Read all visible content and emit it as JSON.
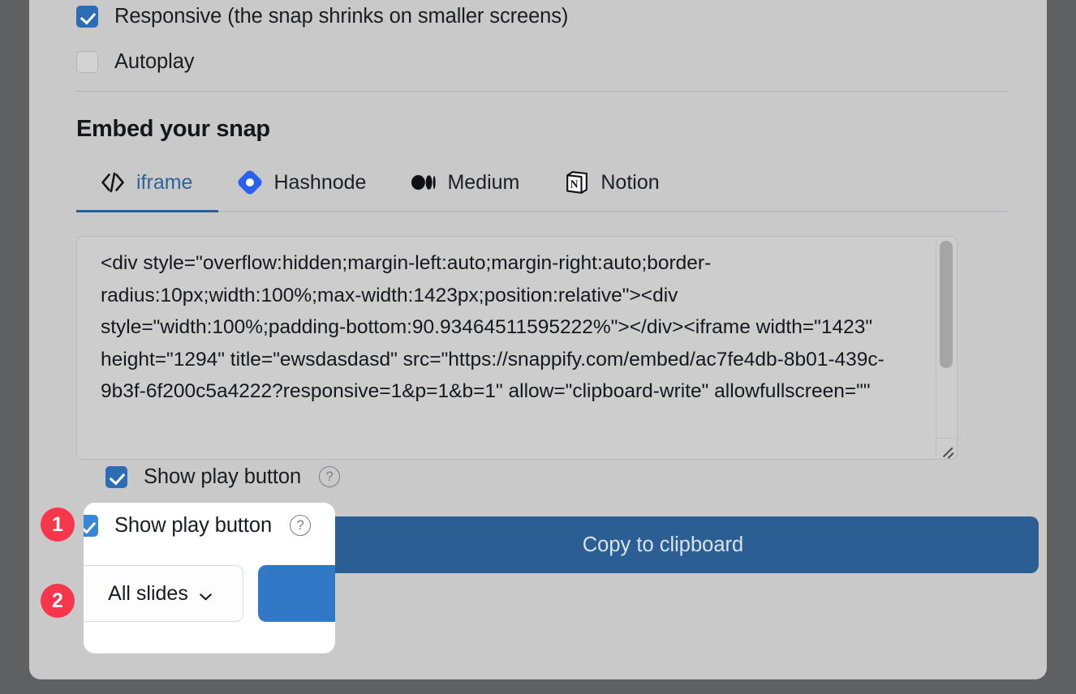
{
  "options": [
    {
      "label": "Responsive (the snap shrinks on smaller screens)",
      "checked": true,
      "name": "responsive"
    },
    {
      "label": "Autoplay",
      "checked": false,
      "name": "autoplay"
    }
  ],
  "section": {
    "title": "Embed your snap"
  },
  "tabs": [
    {
      "label": "iframe",
      "icon": "code-brackets-icon",
      "active": true
    },
    {
      "label": "Hashnode",
      "icon": "hashnode-icon",
      "active": false
    },
    {
      "label": "Medium",
      "icon": "medium-icon",
      "active": false
    },
    {
      "label": "Notion",
      "icon": "notion-icon",
      "active": false
    }
  ],
  "code": {
    "value": "<div style=\"overflow:hidden;margin-left:auto;margin-right:auto;border-radius:10px;width:100%;max-width:1423px;position:relative\"><div style=\"width:100%;padding-bottom:90.93464511595222%\"></div><iframe width=\"1423\" height=\"1294\" title=\"ewsdasdasd\" src=\"https://snappify.com/embed/ac7fe4db-8b01-439c-9b3f-6f200c5a4222?responsive=1&p=1&b=1\" allow=\"clipboard-write\" allowfullscreen=\"\""
  },
  "controls": {
    "play_button_label": "Show play button",
    "play_button_checked": true,
    "help_icon_glyph": "?",
    "slides_select_value": "All slides",
    "copy_button_label": "Copy to clipboard"
  },
  "badges": [
    {
      "number": "1"
    },
    {
      "number": "2"
    }
  ],
  "colors": {
    "accent_blue": "#2b5f94",
    "bright_blue": "#3178c6",
    "checkbox_blue": "#2b6cb5",
    "badge_red": "#f6374b",
    "modal_bg": "#c9c9c9",
    "backdrop": "#5f6061"
  }
}
